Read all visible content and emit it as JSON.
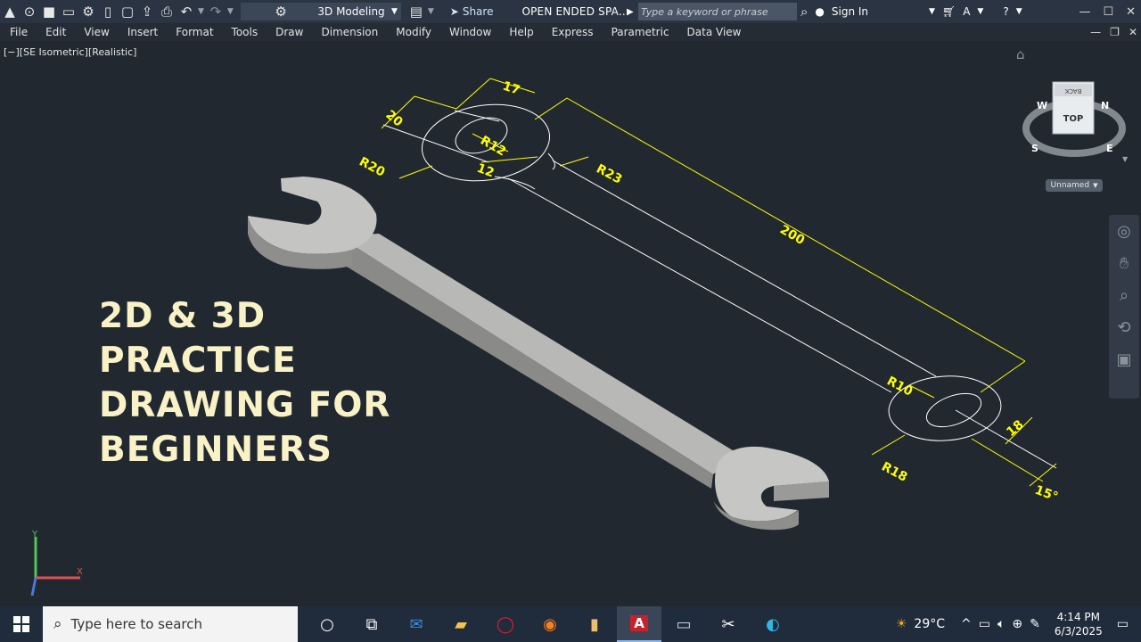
{
  "qat": {
    "workspace": "3D Modeling",
    "share_label": "Share",
    "doc_title": "OPEN ENDED SPA...",
    "search_placeholder": "Type a keyword or phrase",
    "signin_label": "Sign In"
  },
  "menu": [
    "File",
    "Edit",
    "View",
    "Insert",
    "Format",
    "Tools",
    "Draw",
    "Dimension",
    "Modify",
    "Window",
    "Help",
    "Express",
    "Parametric",
    "Data View"
  ],
  "viewport": {
    "label": "[−][SE Isometric][Realistic]"
  },
  "viewcube": {
    "face": "TOP",
    "back": "BACK",
    "n": "N",
    "s": "S",
    "e": "E",
    "w": "W",
    "named_view": "Unnamed"
  },
  "overlay_text": [
    "2D & 3D",
    "PRACTICE",
    "DRAWING FOR",
    "BEGINNERS"
  ],
  "dimensions": {
    "d17": "17",
    "d20": "20",
    "r12": "R12",
    "d12": "12",
    "r20": "R20",
    "r23": "R23",
    "d200": "200",
    "r10": "R10",
    "d18": "18",
    "r18": "R18",
    "a15": "15°"
  },
  "ucs": {
    "x": "X",
    "y": "Y"
  },
  "taskbar": {
    "search_placeholder": "Type here to search",
    "temperature": "29°C",
    "time": "4:14 PM",
    "date": "6/3/2025"
  },
  "colors": {
    "dim_yellow": "#ffff00",
    "canvas": "#212830",
    "overlay_text": "#f9f2c6"
  }
}
